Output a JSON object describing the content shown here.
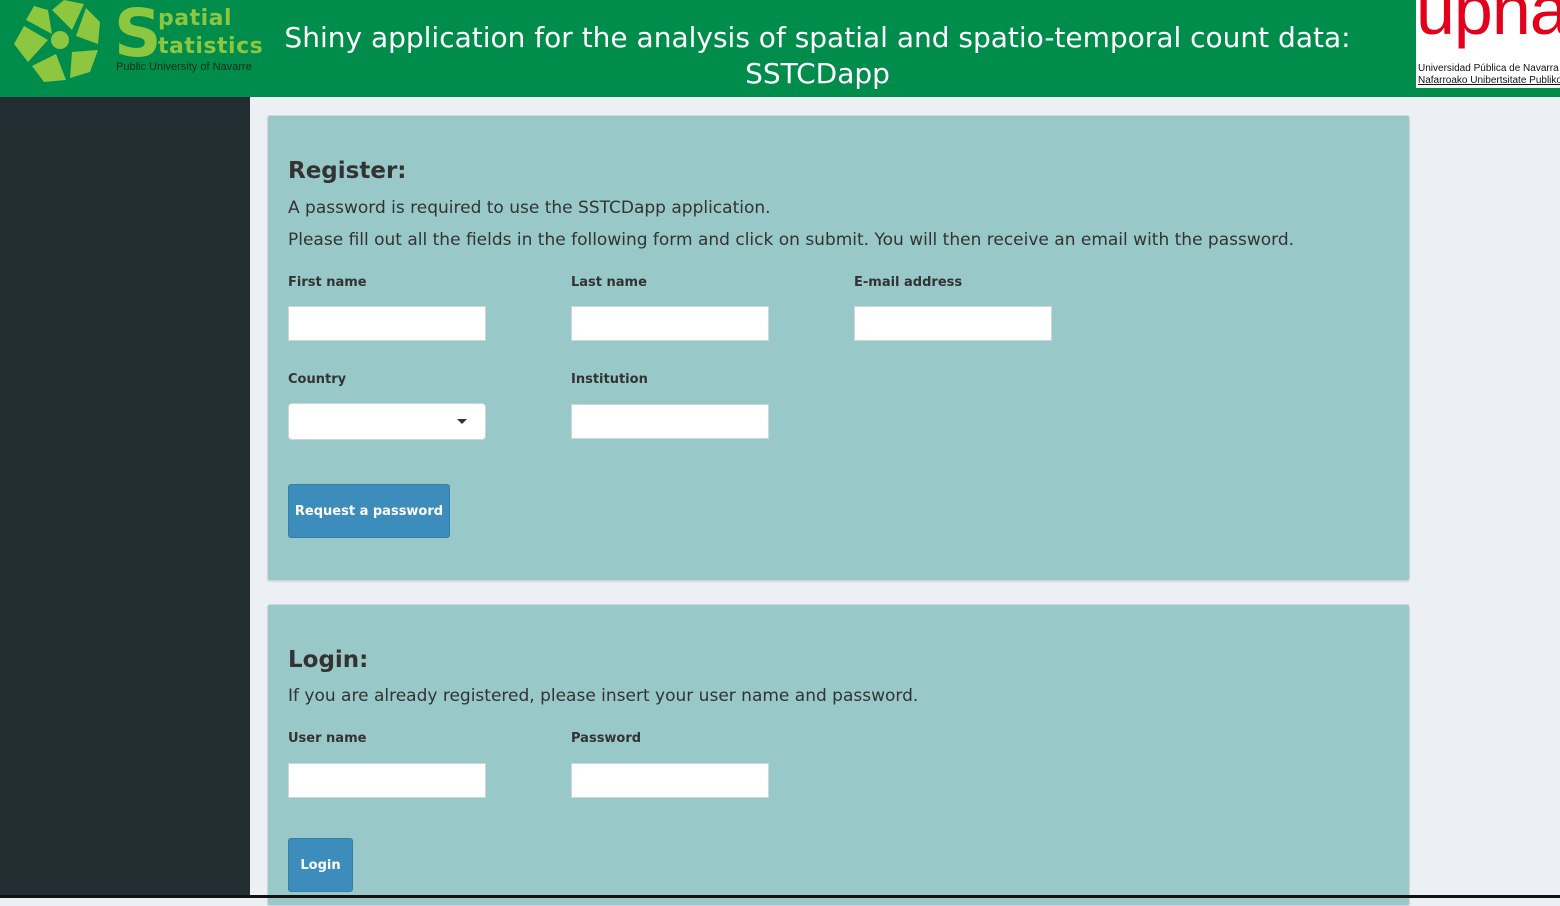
{
  "header": {
    "title_line1": "Shiny application for the analysis of spatial and spatio-temporal count data:",
    "title_line2": "SSTCDapp",
    "logo_left": {
      "big_letter": "S",
      "word1": "patial",
      "word2": "tatistics",
      "subtitle": "Public University of Navarre"
    },
    "logo_right": {
      "mark": "upna",
      "line1": "Universidad Pública de Navarra",
      "line2": "Nafarroako Unibertsitate Publikoa"
    }
  },
  "colors": {
    "header_bg": "#008d4c",
    "sidebar_bg": "#222d32",
    "content_bg": "#ecf0f5",
    "box_bg": "#98c8c8",
    "button_bg": "#3c8dbc",
    "logo_green": "#8dc63f",
    "upna_red": "#e2001a"
  },
  "register": {
    "heading": "Register:",
    "text1": "A password is required to use the SSTCDapp application.",
    "text2": "Please fill out all the fields in the following form and click on submit. You will then receive an email with the password.",
    "fields": {
      "first_name": {
        "label": "First name",
        "value": ""
      },
      "last_name": {
        "label": "Last name",
        "value": ""
      },
      "email": {
        "label": "E-mail address",
        "value": ""
      },
      "country": {
        "label": "Country",
        "selected": ""
      },
      "institution": {
        "label": "Institution",
        "value": ""
      }
    },
    "button": "Request a password"
  },
  "login": {
    "heading": "Login:",
    "text": "If you are already registered, please insert your user name and password.",
    "fields": {
      "user_name": {
        "label": "User name",
        "value": ""
      },
      "password": {
        "label": "Password",
        "value": ""
      }
    },
    "button": "Login"
  },
  "icons": {
    "logo_left": "spatial-statistics-logo-icon",
    "dropdown": "caret-down-icon"
  }
}
